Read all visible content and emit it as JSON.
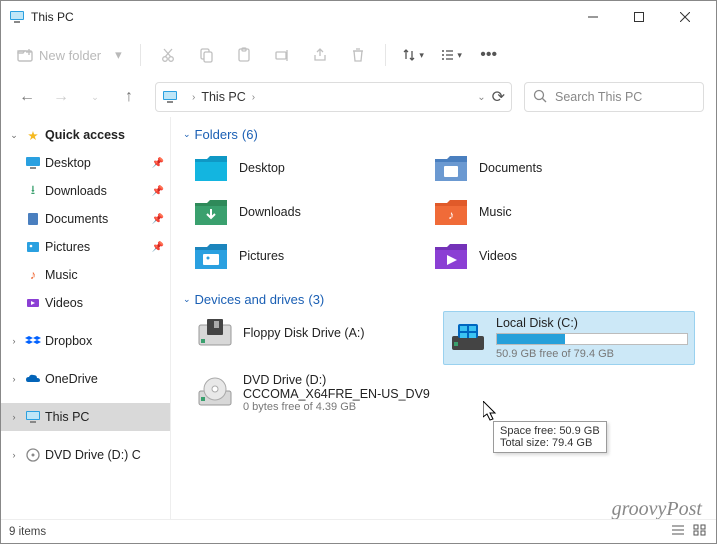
{
  "window": {
    "title": "This PC"
  },
  "toolbar": {
    "new_folder": "New folder"
  },
  "address": {
    "location": "This PC"
  },
  "search": {
    "placeholder": "Search This PC"
  },
  "sidebar": {
    "quick_access": "Quick access",
    "desktop": "Desktop",
    "downloads": "Downloads",
    "documents": "Documents",
    "pictures": "Pictures",
    "music": "Music",
    "videos": "Videos",
    "dropbox": "Dropbox",
    "onedrive": "OneDrive",
    "this_pc": "This PC",
    "dvd_drive": "DVD Drive (D:) C"
  },
  "groups": {
    "folders": {
      "label": "Folders",
      "count": "(6)"
    },
    "drives": {
      "label": "Devices and drives",
      "count": "(3)"
    }
  },
  "folders": {
    "desktop": "Desktop",
    "documents": "Documents",
    "downloads": "Downloads",
    "music": "Music",
    "pictures": "Pictures",
    "videos": "Videos"
  },
  "drives": {
    "floppy": {
      "name": "Floppy Disk Drive (A:)"
    },
    "local": {
      "name": "Local Disk (C:)",
      "sub": "50.9 GB free of 79.4 GB",
      "fill_pct": 36
    },
    "dvd": {
      "name": "DVD Drive (D:)",
      "line2": "CCCOMA_X64FRE_EN-US_DV9",
      "sub": "0 bytes free of 4.39 GB"
    }
  },
  "tooltip": {
    "line1": "Space free: 50.9 GB",
    "line2": "Total size: 79.4 GB"
  },
  "status": {
    "items": "9 items"
  },
  "colors": {
    "folder_desktop": "#0f98c5",
    "folder_documents": "#4a7fbf",
    "folder_downloads": "#3aa06e",
    "folder_music": "#f06b38",
    "folder_pictures": "#2aa0e0",
    "folder_videos": "#8b3fd4"
  }
}
